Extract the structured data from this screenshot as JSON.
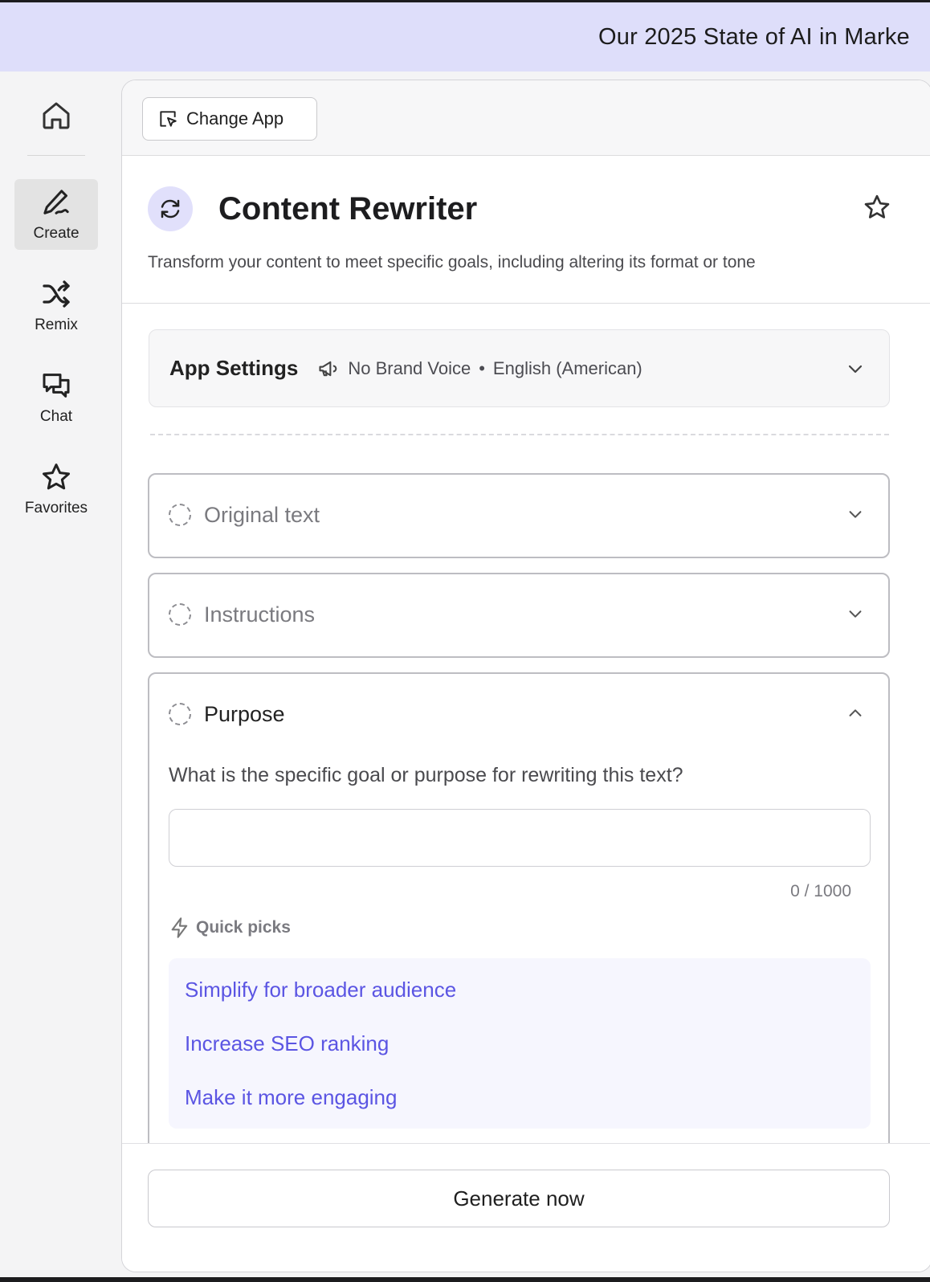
{
  "banner": {
    "text": "Our 2025 State of AI in Marke"
  },
  "sidebar": {
    "items": [
      {
        "label": "Create",
        "icon": "pen-icon",
        "active": true
      },
      {
        "label": "Remix",
        "icon": "shuffle-icon",
        "active": false
      },
      {
        "label": "Chat",
        "icon": "chat-bubbles-icon",
        "active": false
      },
      {
        "label": "Favorites",
        "icon": "star-icon",
        "active": false
      }
    ]
  },
  "toolbar": {
    "change_app_label": "Change App"
  },
  "app": {
    "title": "Content Rewriter",
    "description": "Transform your content to meet specific goals, including altering its format or tone"
  },
  "settings": {
    "title": "App Settings",
    "brand_voice": "No Brand Voice",
    "separator": "•",
    "language": "English (American)"
  },
  "sections": [
    {
      "title": "Original text",
      "expanded": false
    },
    {
      "title": "Instructions",
      "expanded": false
    },
    {
      "title": "Purpose",
      "expanded": true
    }
  ],
  "purpose": {
    "question": "What is the specific goal or purpose for rewriting this text?",
    "value": "",
    "counter": "0 / 1000",
    "quick_picks_label": "Quick picks",
    "quick_picks": [
      "Simplify for broader audience",
      "Increase SEO ranking",
      "Make it more engaging"
    ]
  },
  "footer": {
    "generate_label": "Generate now"
  },
  "colors": {
    "accent": "#5b55e3",
    "banner_bg": "#dedefa",
    "icon_bg": "#e1e0fb"
  }
}
